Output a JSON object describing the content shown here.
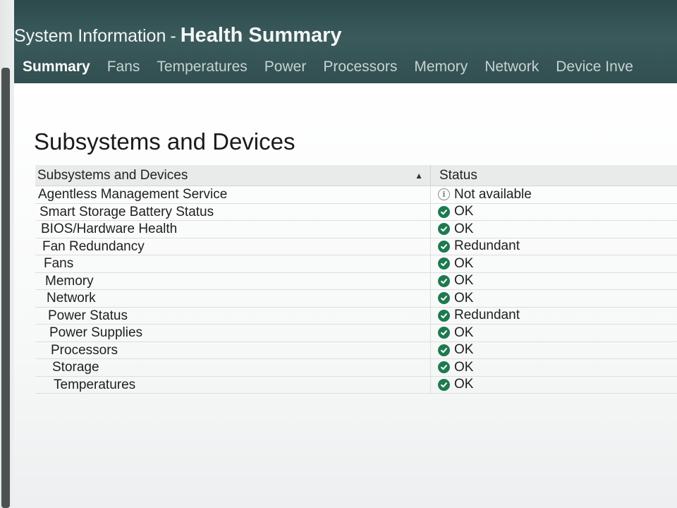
{
  "header": {
    "title_prefix": "System Information",
    "title_sep": "-",
    "title_strong": "Health Summary"
  },
  "tabs": [
    {
      "label": "Summary",
      "active": true
    },
    {
      "label": "Fans"
    },
    {
      "label": "Temperatures"
    },
    {
      "label": "Power"
    },
    {
      "label": "Processors"
    },
    {
      "label": "Memory"
    },
    {
      "label": "Network"
    },
    {
      "label": "Device Inve"
    }
  ],
  "section": {
    "title": "Subsystems and Devices"
  },
  "table": {
    "col_name": "Subsystems and Devices",
    "col_status": "Status",
    "rows": [
      {
        "name": "Agentless Management Service",
        "status": "Not available",
        "icon": "info-icon"
      },
      {
        "name": "Smart Storage Battery Status",
        "status": "OK",
        "icon": "ok-icon"
      },
      {
        "name": "BIOS/Hardware Health",
        "status": "OK",
        "icon": "ok-icon"
      },
      {
        "name": "Fan Redundancy",
        "status": "Redundant",
        "icon": "ok-icon"
      },
      {
        "name": "Fans",
        "status": "OK",
        "icon": "ok-icon"
      },
      {
        "name": "Memory",
        "status": "OK",
        "icon": "ok-icon"
      },
      {
        "name": "Network",
        "status": "OK",
        "icon": "ok-icon"
      },
      {
        "name": "Power Status",
        "status": "Redundant",
        "icon": "ok-icon"
      },
      {
        "name": "Power Supplies",
        "status": "OK",
        "icon": "ok-icon"
      },
      {
        "name": "Processors",
        "status": "OK",
        "icon": "ok-icon"
      },
      {
        "name": "Storage",
        "status": "OK",
        "icon": "ok-icon"
      },
      {
        "name": "Temperatures",
        "status": "OK",
        "icon": "ok-icon"
      }
    ]
  },
  "colors": {
    "header_bg": "#3a5a5b",
    "ok_green": "#1e7a4e"
  }
}
